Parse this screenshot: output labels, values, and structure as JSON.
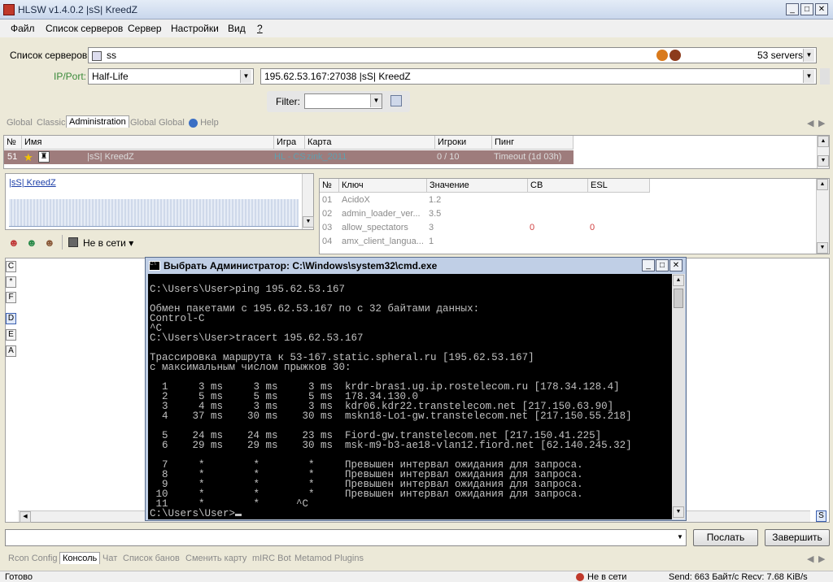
{
  "window": {
    "title": "HLSW v1.4.0.2  |sS| KreedZ"
  },
  "menu": [
    "Файл",
    "Список серверов",
    "Сервер",
    "Настройки",
    "Вид",
    "?"
  ],
  "server_list": {
    "label": "Список серверов:",
    "value": "ss",
    "count": "53 servers"
  },
  "ipport": {
    "label": "IP/Port:",
    "game": "Half-Life",
    "address": "195.62.53.167:27038 |sS| KreedZ"
  },
  "filter": {
    "label": "Filter:",
    "value": ""
  },
  "top_tabs": [
    "Global",
    "Classic",
    "Administration",
    "Global",
    "Global",
    "Help"
  ],
  "server_table": {
    "headers": [
      "№",
      "Имя",
      "Игра",
      "Карта",
      "Игроки",
      "Пинг"
    ],
    "rows": [
      {
        "num": "51",
        "name": "|sS| KreedZ",
        "game": "HL - CS",
        "map": "zink_2011",
        "players": "0 / 10",
        "ping": "Timeout (1d 03h)"
      }
    ]
  },
  "graph_panel": {
    "server_name": "|sS| KreedZ",
    "status": "Не в сети"
  },
  "rules_table": {
    "headers": [
      "№",
      "Ключ",
      "Значение",
      "CB",
      "ESL"
    ],
    "rows": [
      {
        "num": "01",
        "key": "AcidoX",
        "value": "1.2",
        "cb": "",
        "esl": ""
      },
      {
        "num": "02",
        "key": "admin_loader_ver...",
        "value": "3.5",
        "cb": "",
        "esl": ""
      },
      {
        "num": "03",
        "key": "allow_spectators",
        "value": "3",
        "cb": "0",
        "esl": "0"
      },
      {
        "num": "04",
        "key": "amx_client_langua...",
        "value": "1",
        "cb": "",
        "esl": ""
      }
    ]
  },
  "side_buttons": [
    "C",
    "*",
    "F",
    "D",
    "E",
    "A"
  ],
  "cmd": {
    "title": "Выбрать Администратор: C:\\Windows\\system32\\cmd.exe",
    "lines": [
      "C:\\Users\\User>ping 195.62.53.167",
      "",
      "Обмен пакетами с 195.62.53.167 по с 32 байтами данных:",
      "Control-C",
      "^C",
      "C:\\Users\\User>tracert 195.62.53.167",
      "",
      "Трассировка маршрута к 53-167.static.spheral.ru [195.62.53.167]",
      "с максимальным числом прыжков 30:",
      "",
      "  1     3 ms     3 ms     3 ms  krdr-bras1.ug.ip.rostelecom.ru [178.34.128.4]",
      "  2     5 ms     5 ms     5 ms  178.34.130.0",
      "  3     4 ms     3 ms     3 ms  kdr06.kdr22.transtelecom.net [217.150.63.90]",
      "  4    37 ms    30 ms    30 ms  mskn18-Lo1-gw.transtelecom.net [217.150.55.218]",
      "",
      "  5    24 ms    24 ms    23 ms  Fiord-gw.transtelecom.net [217.150.41.225]",
      "  6    29 ms    29 ms    30 ms  msk-m9-b3-ae18-vlan12.fiord.net [62.140.245.32]",
      "",
      "  7     *        *        *     Превышен интервал ожидания для запроса.",
      "  8     *        *        *     Превышен интервал ожидания для запроса.",
      "  9     *        *        *     Превышен интервал ожидания для запроса.",
      " 10     *        *        *     Превышен интервал ожидания для запроса.",
      " 11     *        *      ^C",
      "C:\\Users\\User>"
    ]
  },
  "command_bar": {
    "send": "Послать",
    "finish": "Завершить"
  },
  "bottom_tabs": [
    "Rcon Config",
    "Консоль",
    "Чат",
    "Список банов",
    "Сменить карту",
    "mIRC Bot",
    "Metamod Plugins"
  ],
  "status": {
    "ready": "Готово",
    "online": "Не в сети",
    "traffic": "Send: 663 Байт/с Recv: 7.68 KiB/s"
  },
  "colors": {
    "selected_row": "#9e7c7c",
    "console_bg": "#000000",
    "console_fg": "#c0c0c0"
  }
}
